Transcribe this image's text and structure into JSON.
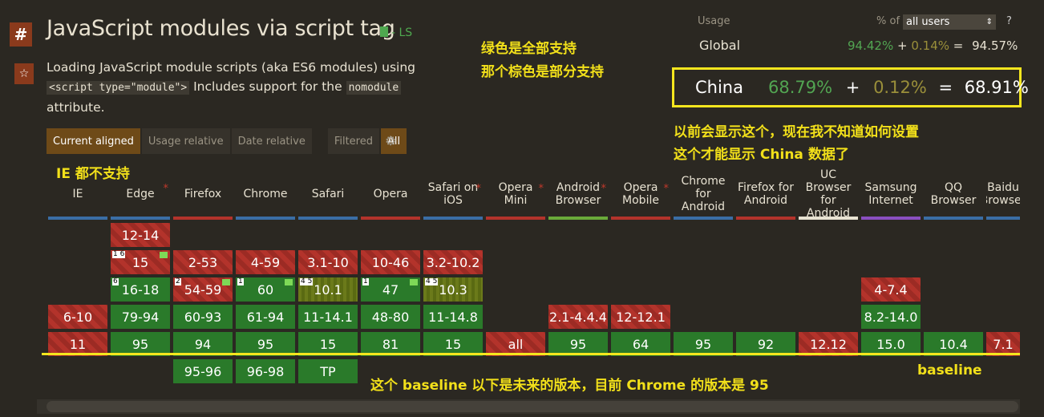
{
  "feature": {
    "title": "JavaScript modules via script tag",
    "status": "- LS",
    "desc_pre": "Loading JavaScript module scripts (aka ES6 modules) using",
    "desc_code1": "<script type=\"module\">",
    "desc_mid": " Includes support for the ",
    "desc_code2": "nomodule",
    "desc_post": "attribute."
  },
  "toolbar": {
    "current_aligned": "Current aligned",
    "usage_relative": "Usage relative",
    "date_relative": "Date relative",
    "filtered": "Filtered",
    "all": "All"
  },
  "usage": {
    "label": "Usage",
    "pct_of": "% of",
    "select_value": "all users",
    "help": "?",
    "global_label": "Global",
    "global_full": "94.42%",
    "global_partial": "0.14%",
    "global_total": "94.57%",
    "plus": "+",
    "eq": "=",
    "china_label": "China",
    "china_full": "68.79%",
    "china_partial": "0.12%",
    "china_total": "68.91%"
  },
  "annotations": {
    "green_note_1": "绿色是全部支持",
    "green_note_2": "那个棕色是部分支持",
    "china_note_1": "以前会显示这个，现在我不知道如何设置",
    "china_note_2": "这个才能显示 China 数据了",
    "ie_note": "IE 都不支持",
    "baseline_note": "这个 baseline 以下是未来的版本，目前 Chrome 的版本是 95",
    "baseline_label": "baseline"
  },
  "browsers": [
    {
      "name": "IE",
      "color": "#3a6ea5",
      "star": false
    },
    {
      "name": "Edge",
      "color": "#3a6ea5",
      "star": true
    },
    {
      "name": "Firefox",
      "color": "#b3332b",
      "star": false
    },
    {
      "name": "Chrome",
      "color": "#3a6ea5",
      "star": false
    },
    {
      "name": "Safari",
      "color": "#3a6ea5",
      "star": false
    },
    {
      "name": "Opera",
      "color": "#b3332b",
      "star": false
    },
    {
      "name": "Safari on iOS",
      "color": "#3a6ea5",
      "star": true
    },
    {
      "name": "Opera Mini",
      "color": "#b3332b",
      "star": true
    },
    {
      "name": "Android Browser",
      "color": "#6aaa3a",
      "star": true
    },
    {
      "name": "Opera Mobile",
      "color": "#b3332b",
      "star": true
    },
    {
      "name": "Chrome for Android",
      "color": "#3a6ea5",
      "star": false
    },
    {
      "name": "Firefox for Android",
      "color": "#b3332b",
      "star": false
    },
    {
      "name": "UC Browser for Android",
      "color": "#e8e2d2",
      "star": false
    },
    {
      "name": "Samsung Internet",
      "color": "#8a4fc0",
      "star": false
    },
    {
      "name": "QQ Browser",
      "color": "#3a6ea5",
      "star": false
    },
    {
      "name": "Baidu Browser",
      "color": "#3a6ea5",
      "star": false
    }
  ],
  "cells": {
    "edge": [
      "12-14",
      "15",
      "16-18",
      "79-94",
      "95"
    ],
    "firefox": [
      "2-53",
      "54-59",
      "60-93",
      "94",
      "95-96"
    ],
    "chrome": [
      "4-59",
      "60",
      "61-94",
      "95",
      "96-98"
    ],
    "safari": [
      "3.1-10",
      "10.1",
      "11-14.1",
      "15",
      "TP"
    ],
    "opera": [
      "10-46",
      "47",
      "48-80",
      "81"
    ],
    "ios": [
      "3.2-10.2",
      "10.3",
      "11-14.8",
      "15"
    ],
    "ie": [
      "6-10",
      "11"
    ],
    "opmini": [
      "all"
    ],
    "android": [
      "2.1-4.4.4",
      "95"
    ],
    "opmob": [
      "12-12.1",
      "64"
    ],
    "cfa": [
      "95"
    ],
    "ffa": [
      "92"
    ],
    "uc": [
      "12.12"
    ],
    "samsung": [
      "4-7.4",
      "8.2-14.0",
      "15.0"
    ],
    "qq": [
      "10.4"
    ],
    "baidu": [
      "7.1"
    ]
  },
  "notes": {
    "edge15": "1 6",
    "edge16": "6",
    "ff54": "2",
    "ch60": "1",
    "saf101": "4 5",
    "op47": "1",
    "ios103": "4 5"
  }
}
